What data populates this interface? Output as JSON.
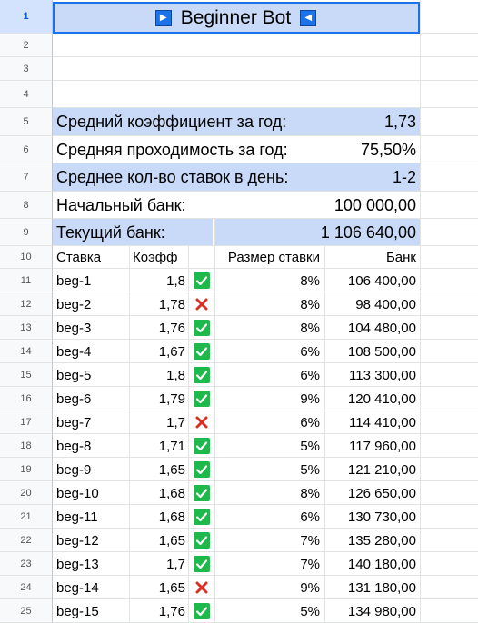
{
  "title": "Beginner Bot",
  "nav": {
    "left_icon": "play-right-icon",
    "right_icon": "play-left-icon"
  },
  "row_numbers": [
    "1",
    "2",
    "3",
    "4",
    "5",
    "6",
    "7",
    "8",
    "9",
    "10",
    "11",
    "12",
    "13",
    "14",
    "15",
    "16",
    "17",
    "18",
    "19",
    "20",
    "21",
    "22",
    "23",
    "24",
    "25"
  ],
  "summary": [
    {
      "label": "Средний коэффициент за год:",
      "value": "1,73"
    },
    {
      "label": "Средняя проходимость за год:",
      "value": "75,50%"
    },
    {
      "label": "Среднее кол-во ставок в день:",
      "value": "1-2"
    },
    {
      "label": "Начальный банк:",
      "value": "100 000,00"
    },
    {
      "label": "Текущий банк:",
      "value": "1 106 640,00"
    }
  ],
  "table": {
    "headers": [
      "Ставка",
      "Коэфф",
      "",
      "Размер ставки",
      "Банк"
    ],
    "rows": [
      {
        "bet": "beg-1",
        "coef": "1,8",
        "result": "win",
        "size": "8%",
        "bank": "106 400,00"
      },
      {
        "bet": "beg-2",
        "coef": "1,78",
        "result": "loss",
        "size": "8%",
        "bank": "98 400,00"
      },
      {
        "bet": "beg-3",
        "coef": "1,76",
        "result": "win",
        "size": "8%",
        "bank": "104 480,00"
      },
      {
        "bet": "beg-4",
        "coef": "1,67",
        "result": "win",
        "size": "6%",
        "bank": "108 500,00"
      },
      {
        "bet": "beg-5",
        "coef": "1,8",
        "result": "win",
        "size": "6%",
        "bank": "113 300,00"
      },
      {
        "bet": "beg-6",
        "coef": "1,79",
        "result": "win",
        "size": "9%",
        "bank": "120 410,00"
      },
      {
        "bet": "beg-7",
        "coef": "1,7",
        "result": "loss",
        "size": "6%",
        "bank": "114 410,00"
      },
      {
        "bet": "beg-8",
        "coef": "1,71",
        "result": "win",
        "size": "5%",
        "bank": "117 960,00"
      },
      {
        "bet": "beg-9",
        "coef": "1,65",
        "result": "win",
        "size": "5%",
        "bank": "121 210,00"
      },
      {
        "bet": "beg-10",
        "coef": "1,68",
        "result": "win",
        "size": "8%",
        "bank": "126 650,00"
      },
      {
        "bet": "beg-11",
        "coef": "1,68",
        "result": "win",
        "size": "6%",
        "bank": "130 730,00"
      },
      {
        "bet": "beg-12",
        "coef": "1,65",
        "result": "win",
        "size": "7%",
        "bank": "135 280,00"
      },
      {
        "bet": "beg-13",
        "coef": "1,7",
        "result": "win",
        "size": "7%",
        "bank": "140 180,00"
      },
      {
        "bet": "beg-14",
        "coef": "1,65",
        "result": "loss",
        "size": "9%",
        "bank": "131 180,00"
      },
      {
        "bet": "beg-15",
        "coef": "1,76",
        "result": "win",
        "size": "5%",
        "bank": "134 980,00"
      }
    ]
  },
  "colors": {
    "highlight": "#c9daf8",
    "win": "#1fb84a",
    "loss": "#d93025",
    "selection": "#1a73e8",
    "row_header_bg": "#f8f9fa",
    "gridline": "#e2e3e3"
  },
  "icons": {
    "win": "green-check-icon",
    "loss": "red-cross-icon"
  }
}
